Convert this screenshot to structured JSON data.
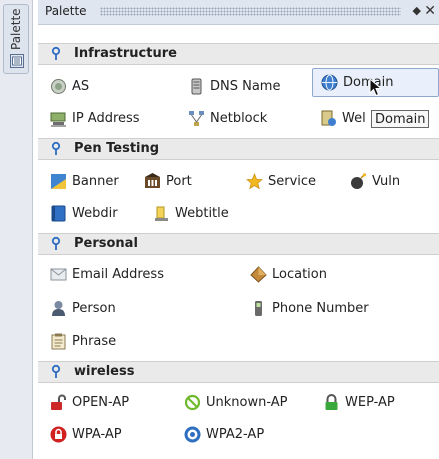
{
  "side_tab": {
    "label": "Palette",
    "icon": "palette-icon"
  },
  "panel": {
    "title": "Palette",
    "menu_glyph": "◆",
    "close_glyph": "✕"
  },
  "tooltip": {
    "text": "Domain"
  },
  "sections": {
    "infrastructure": {
      "title": "Infrastructure",
      "items": {
        "as": "AS",
        "dns_name": "DNS Name",
        "domain": "Domain",
        "ip_address": "IP Address",
        "netblock": "Netblock",
        "website": "Wel"
      }
    },
    "pen_testing": {
      "title": "Pen Testing",
      "items": {
        "banner": "Banner",
        "port": "Port",
        "service": "Service",
        "vuln": "Vuln",
        "webdir": "Webdir",
        "webtitle": "Webtitle"
      }
    },
    "personal": {
      "title": "Personal",
      "items": {
        "email": "Email Address",
        "location": "Location",
        "person": "Person",
        "phone": "Phone Number",
        "phrase": "Phrase"
      }
    },
    "wireless": {
      "title": "wireless",
      "items": {
        "open_ap": "OPEN-AP",
        "unknown_ap": "Unknown-AP",
        "wep_ap": "WEP-AP",
        "wpa_ap": "WPA-AP",
        "wpa2_ap": "WPA2-AP"
      }
    }
  },
  "colors": {
    "header_bg": "#eaeaea",
    "titlebar_bg": "#dfe6f0",
    "selected_border": "#8ea8d0",
    "pin_blue": "#2d6cc0"
  }
}
